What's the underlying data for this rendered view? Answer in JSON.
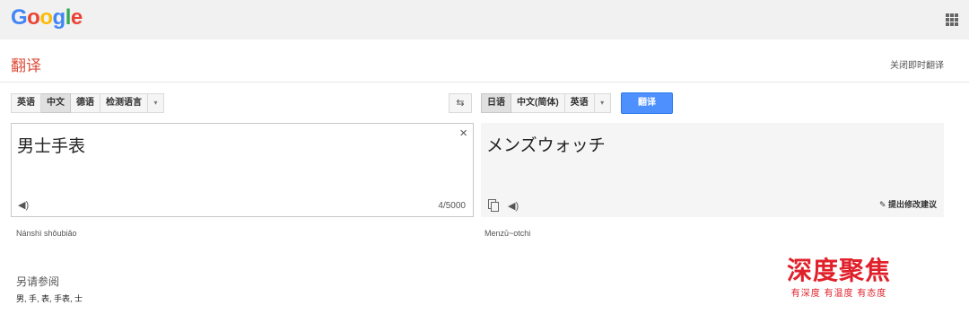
{
  "brand": {
    "letters": [
      {
        "ch": "G",
        "color": "#4285f4"
      },
      {
        "ch": "o",
        "color": "#ea4335"
      },
      {
        "ch": "o",
        "color": "#fbbc05"
      },
      {
        "ch": "g",
        "color": "#4285f4"
      },
      {
        "ch": "l",
        "color": "#34a853"
      },
      {
        "ch": "e",
        "color": "#ea4335"
      }
    ],
    "apps_icon": "apps-grid-icon"
  },
  "header": {
    "title": "翻译",
    "instant_link": "关闭即时翻译"
  },
  "source_langs": [
    {
      "label": "英语",
      "active": false
    },
    {
      "label": "中文",
      "active": true
    },
    {
      "label": "德语",
      "active": false
    },
    {
      "label": "检测语言",
      "active": false
    }
  ],
  "target_langs": [
    {
      "label": "日语",
      "active": true
    },
    {
      "label": "中文(简体)",
      "active": false
    },
    {
      "label": "英语",
      "active": false
    }
  ],
  "dropdown_glyph": "▾",
  "swap_glyph": "⇆",
  "translate_button": "翻译",
  "source": {
    "text": "男士手表",
    "clear_glyph": "×",
    "speaker_glyph": "◀)",
    "count": "4/5000",
    "romanization": "Nánshì shǒubiǎo"
  },
  "target": {
    "text": "メンズウォッチ",
    "speaker_glyph": "◀)",
    "suggest": "✎ 提出修改建议",
    "romanization": "Menzū~otchi"
  },
  "see_also": {
    "title": "另请参阅",
    "items": "男, 手, 表, 手表, 士"
  },
  "watermark": {
    "main": "深度聚焦",
    "sub": "有深度 有温度 有态度"
  }
}
